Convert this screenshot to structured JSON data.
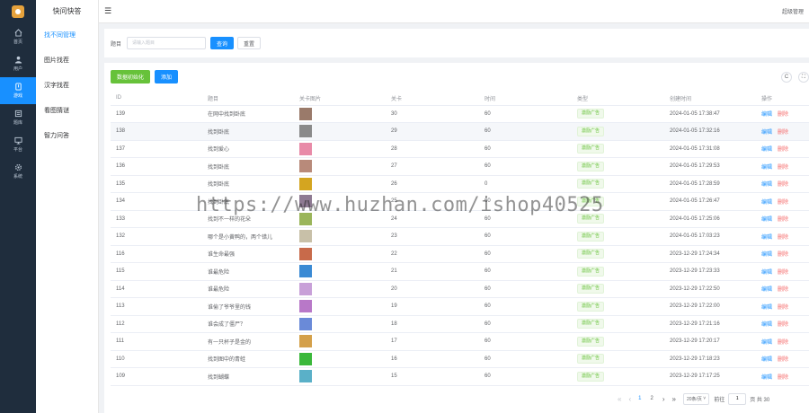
{
  "rail": [
    {
      "label": "首页",
      "icon": "home-icon"
    },
    {
      "label": "用户",
      "icon": "user-icon"
    },
    {
      "label": "游戏",
      "icon": "game-icon",
      "active": true
    },
    {
      "label": "题库",
      "icon": "book-icon"
    },
    {
      "label": "平台",
      "icon": "monitor-icon"
    },
    {
      "label": "系统",
      "icon": "settings-icon"
    }
  ],
  "submenu": {
    "title": "快问快答",
    "items": [
      {
        "label": "找不同管理",
        "active": true
      },
      {
        "label": "图片找茬"
      },
      {
        "label": "汉字找茬"
      },
      {
        "label": "看图猜谜"
      },
      {
        "label": "智力问答"
      }
    ]
  },
  "topbar": {
    "user": "超级管理"
  },
  "search": {
    "label": "题目",
    "placeholder": "请输入题目",
    "search_btn": "查询",
    "reset_btn": "重置"
  },
  "toolbar": {
    "init_btn": "数据初始化",
    "add_btn": "添加",
    "refresh_icon": "C",
    "fullscreen_icon": "⛶"
  },
  "table": {
    "columns": [
      "ID",
      "题目",
      "关卡图片",
      "关卡",
      "时间",
      "类型",
      "创建时间",
      "操作"
    ],
    "edit_label": "编辑",
    "delete_label": "删除",
    "rows": [
      {
        "id": "139",
        "title": "在网中找到卧底",
        "thumb": "#9a7a6a",
        "level": "30",
        "time": "60",
        "type": "激励广告",
        "created": "2024-01-05 17:38:47"
      },
      {
        "id": "138",
        "title": "找到卧底",
        "thumb": "#8a8a8a",
        "level": "29",
        "time": "60",
        "type": "激励广告",
        "created": "2024-01-05 17:32:16"
      },
      {
        "id": "137",
        "title": "找到爱心",
        "thumb": "#e88aa8",
        "level": "28",
        "time": "60",
        "type": "激励广告",
        "created": "2024-01-05 17:31:08"
      },
      {
        "id": "136",
        "title": "找到卧底",
        "thumb": "#b88a7a",
        "level": "27",
        "time": "60",
        "type": "激励广告",
        "created": "2024-01-05 17:29:53"
      },
      {
        "id": "135",
        "title": "找到卧底",
        "thumb": "#d4a520",
        "level": "26",
        "time": "0",
        "type": "激励广告",
        "created": "2024-01-05 17:28:59"
      },
      {
        "id": "134",
        "title": "找到卧底",
        "thumb": "#8e7a92",
        "level": "25",
        "time": "60",
        "type": "激励广告",
        "created": "2024-01-05 17:26:47"
      },
      {
        "id": "133",
        "title": "找到不一样的花朵",
        "thumb": "#9ab55a",
        "level": "24",
        "time": "60",
        "type": "激励广告",
        "created": "2024-01-05 17:25:06"
      },
      {
        "id": "132",
        "title": "哪个是小黄鸭的，两个错儿",
        "thumb": "#c8c0a8",
        "level": "23",
        "time": "60",
        "type": "激励广告",
        "created": "2024-01-05 17:03:23"
      },
      {
        "id": "116",
        "title": "谁生命最强",
        "thumb": "#c86a4a",
        "level": "22",
        "time": "60",
        "type": "激励广告",
        "created": "2023-12-29 17:24:34"
      },
      {
        "id": "115",
        "title": "谁最危险",
        "thumb": "#3a8ad4",
        "level": "21",
        "time": "60",
        "type": "激励广告",
        "created": "2023-12-29 17:23:33"
      },
      {
        "id": "114",
        "title": "谁最危险",
        "thumb": "#c8a0d8",
        "level": "20",
        "time": "60",
        "type": "激励广告",
        "created": "2023-12-29 17:22:50"
      },
      {
        "id": "113",
        "title": "谁偷了爷爷里的钱",
        "thumb": "#b878c8",
        "level": "19",
        "time": "60",
        "type": "激励广告",
        "created": "2023-12-29 17:22:00"
      },
      {
        "id": "112",
        "title": "谁会成了僵尸？",
        "thumb": "#6a8ad8",
        "level": "18",
        "time": "60",
        "type": "激励广告",
        "created": "2023-12-29 17:21:16"
      },
      {
        "id": "111",
        "title": "有一只杯子是金的",
        "thumb": "#d4a04a",
        "level": "17",
        "time": "60",
        "type": "激励广告",
        "created": "2023-12-29 17:20:17"
      },
      {
        "id": "110",
        "title": "找到图中的青蛙",
        "thumb": "#3ab83a",
        "level": "16",
        "time": "60",
        "type": "激励广告",
        "created": "2023-12-29 17:18:23"
      },
      {
        "id": "109",
        "title": "找到蝴蝶",
        "thumb": "#5ab0c8",
        "level": "15",
        "time": "60",
        "type": "激励广告",
        "created": "2023-12-29 17:17:25"
      }
    ]
  },
  "pagination": {
    "pages": [
      "1",
      "2"
    ],
    "active_page": "1",
    "page_size": "20条/页",
    "goto_label": "前往",
    "goto_value": "1",
    "total_suffix": "页 共 30"
  },
  "watermark": "https://www.huzhan.com/ishop40525"
}
